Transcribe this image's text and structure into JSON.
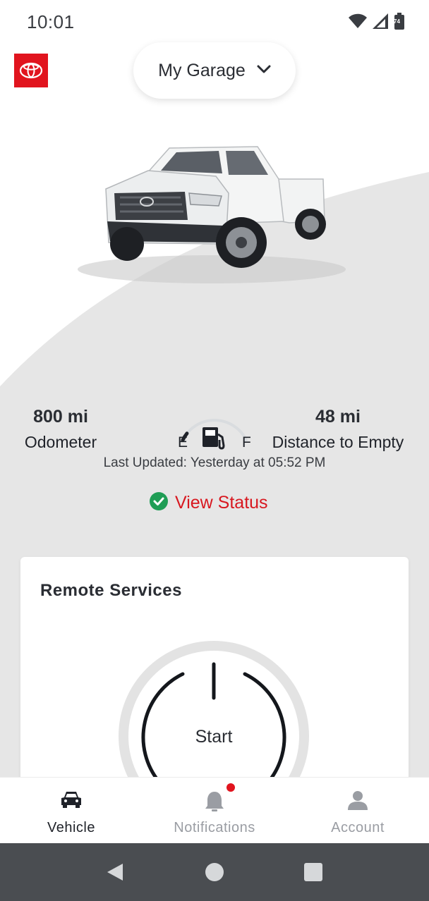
{
  "status_bar": {
    "time": "10:01",
    "battery_level": "74",
    "icons": [
      "wifi-icon",
      "cellular-signal-icon",
      "battery-icon"
    ]
  },
  "header": {
    "logo": "toyota-logo",
    "garage_selector": {
      "label": "My Garage",
      "icon": "chevron-down-icon"
    }
  },
  "vehicle": {
    "image": "white-pickup-truck",
    "odometer": {
      "value": "800 mi",
      "label": "Odometer"
    },
    "fuel": {
      "empty_label": "E",
      "full_label": "F",
      "level_fraction": 0.1,
      "icon": "fuel-pump-icon"
    },
    "distance_to_empty": {
      "value": "48 mi",
      "label": "Distance to Empty"
    },
    "last_updated": "Last Updated: Yesterday at 05:52 PM",
    "view_status": {
      "label": "View Status",
      "icon": "check-circle-icon"
    }
  },
  "remote_services": {
    "title": "Remote Services",
    "start_button": {
      "label": "Start",
      "icon": "power-icon"
    }
  },
  "tab_bar": {
    "tabs": [
      {
        "label": "Vehicle",
        "icon": "car-icon",
        "active": true
      },
      {
        "label": "Notifications",
        "icon": "bell-icon",
        "active": false,
        "has_badge": true
      },
      {
        "label": "Account",
        "icon": "person-icon",
        "active": false
      }
    ]
  },
  "system_nav": {
    "buttons": [
      "back-icon",
      "home-icon",
      "recents-icon"
    ]
  },
  "colors": {
    "accent_red": "#e1141e",
    "link_red": "#d8171f",
    "success_green": "#1f9d55",
    "background_gray": "#e6e6e6",
    "text_dark": "#1f2229",
    "nav_bar": "#4a4d51"
  }
}
